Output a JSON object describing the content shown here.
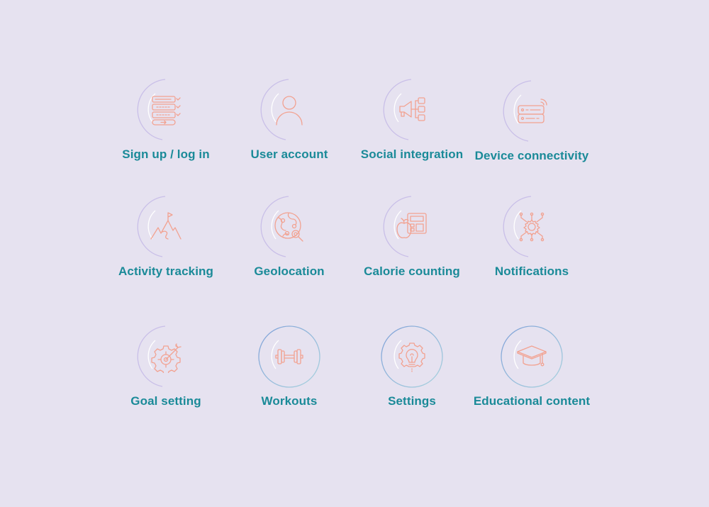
{
  "colors": {
    "background": "#e6e2f0",
    "label": "#1a8a98",
    "icon_stroke": "#f2a291",
    "arc": "#c9bfe8",
    "ring_outline": "#8fb7d6"
  },
  "features": [
    {
      "label": "Sign up / log in",
      "icon": "signup-form-icon",
      "ring": "arc"
    },
    {
      "label": "User account",
      "icon": "user-icon",
      "ring": "arc"
    },
    {
      "label": "Social integration",
      "icon": "megaphone-network-icon",
      "ring": "arc"
    },
    {
      "label": "Device connectivity",
      "icon": "server-wifi-icon",
      "ring": "arc"
    },
    {
      "label": "Activity tracking",
      "icon": "mountain-flag-icon",
      "ring": "arc"
    },
    {
      "label": "Geolocation",
      "icon": "globe-location-icon",
      "ring": "arc"
    },
    {
      "label": "Calorie counting",
      "icon": "apple-calculator-icon",
      "ring": "arc"
    },
    {
      "label": "Notifications",
      "icon": "gear-network-icon",
      "ring": "arc"
    },
    {
      "label": "Goal setting",
      "icon": "gear-target-icon",
      "ring": "arc"
    },
    {
      "label": "Workouts",
      "icon": "dumbbell-icon",
      "ring": "circle"
    },
    {
      "label": "Settings",
      "icon": "gear-lightbulb-icon",
      "ring": "circle"
    },
    {
      "label": "Educational content",
      "icon": "graduation-cap-icon",
      "ring": "circle"
    }
  ]
}
